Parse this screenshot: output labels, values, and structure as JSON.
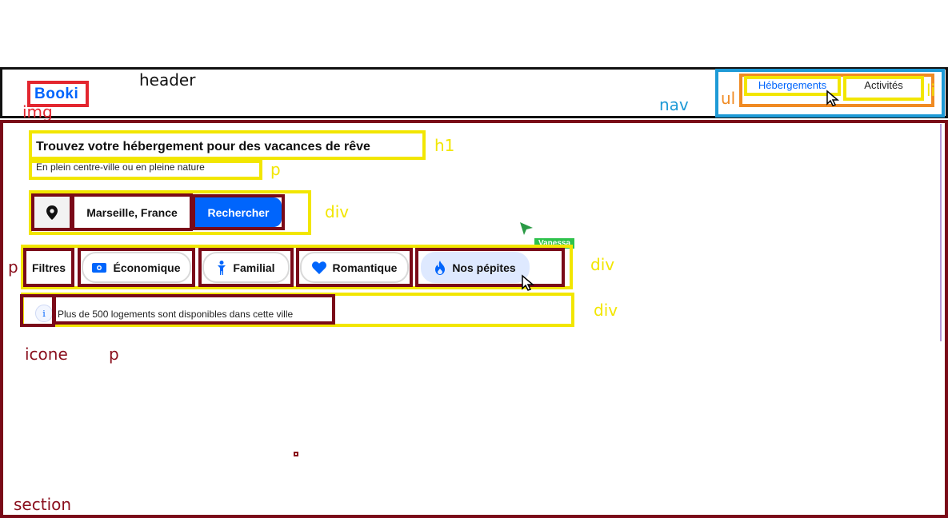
{
  "header": {
    "logo": "Booki",
    "nav": {
      "items": [
        {
          "label": "Hébergements",
          "active": true
        },
        {
          "label": "Activités",
          "active": false
        }
      ]
    }
  },
  "hero": {
    "title": "Trouvez votre hébergement pour des vacances de rêve",
    "subtitle": "En plein centre-ville ou en pleine nature"
  },
  "search": {
    "location_icon": "location-pin-icon",
    "location_value": "Marseille, France",
    "submit_label": "Rechercher"
  },
  "filters": {
    "label": "Filtres",
    "chips": [
      {
        "label": "Économique",
        "icon": "money-bill-icon",
        "active": false
      },
      {
        "label": "Familial",
        "icon": "child-icon",
        "active": false
      },
      {
        "label": "Romantique",
        "icon": "heart-icon",
        "active": false
      },
      {
        "label": "Nos pépites",
        "icon": "fire-icon",
        "active": true
      }
    ]
  },
  "info": {
    "icon": "info-icon",
    "icon_glyph": "i",
    "text": "Plus de 500 logements sont disponibles dans cette ville"
  },
  "cursor_tooltip": {
    "text": "Vanessa"
  },
  "annotations": {
    "header": "header",
    "img": "img",
    "nav": "nav",
    "ul": "ul",
    "li": "li",
    "h1": "h1",
    "p": "p",
    "div_search": "div",
    "div_filters": "div",
    "div_info": "div",
    "p_filters": "p",
    "icone": "icone",
    "p_info": "p",
    "section": "section"
  },
  "colors": {
    "brand": "#0065fc",
    "chip_active_bg": "#dee9ff",
    "annotation_yellow": "#f2e600",
    "annotation_maroon": "#7a0a18",
    "annotation_blue": "#1e9ad6",
    "annotation_orange": "#f08a22",
    "annotation_red": "#e3262f"
  }
}
